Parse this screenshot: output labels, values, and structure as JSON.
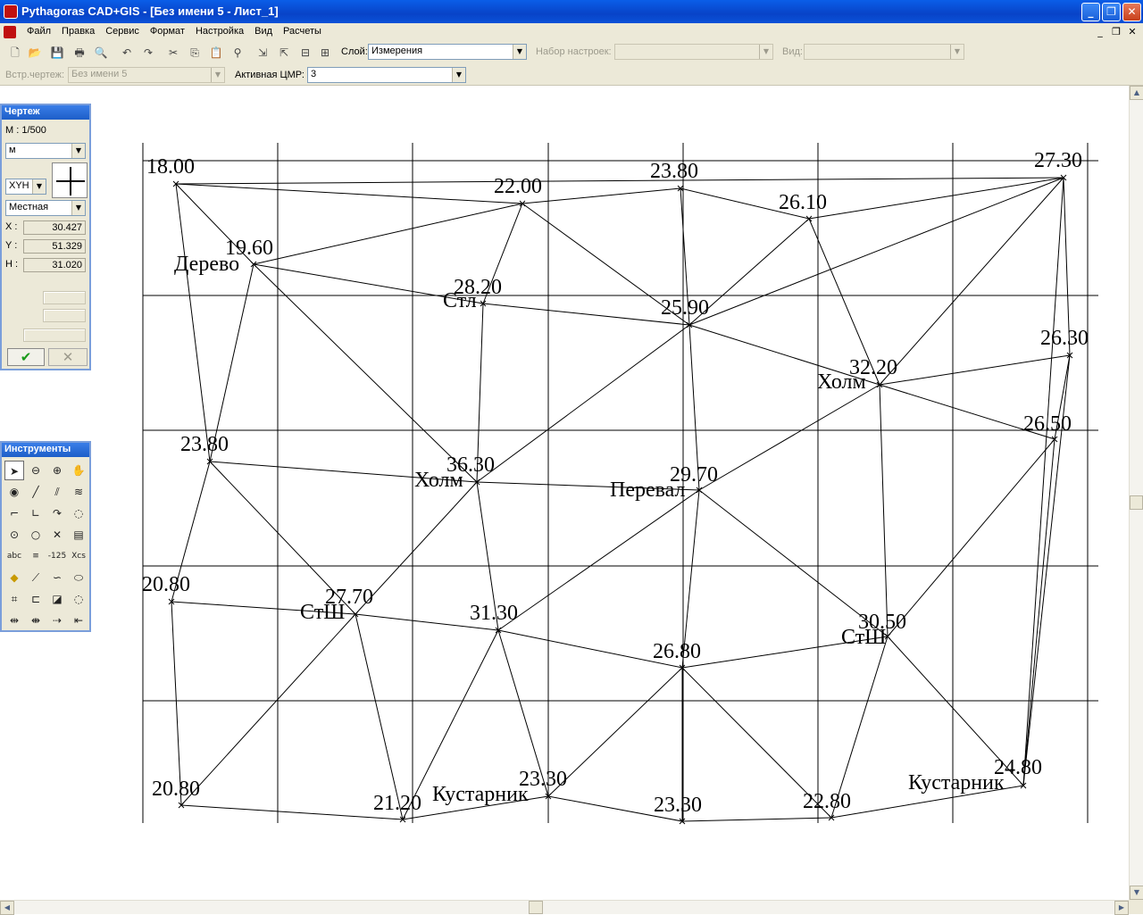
{
  "window": {
    "title": "Pythagoras CAD+GIS - [Без имени  5 - Лист_1]",
    "minimize": "_",
    "maximize": "❐",
    "close": "✕"
  },
  "menu": {
    "items": [
      "Файл",
      "Правка",
      "Сервис",
      "Формат",
      "Настройка",
      "Вид",
      "Расчеты"
    ],
    "mdi_minimize": "_",
    "mdi_restore": "❐",
    "mdi_close": "✕"
  },
  "toolbar": {
    "layer_label": "Слой:",
    "layer_value": "Измерения",
    "settings_label": "Набор настроек:",
    "settings_value": "",
    "view_label": "Вид:",
    "view_value": "",
    "embedded_label": "Встр.чертеж:",
    "embedded_value": "Без имени  5",
    "active_dtm_label": "Активная ЦМР:",
    "active_dtm_value": "3",
    "icons": [
      "new-file-icon",
      "open-folder-icon",
      "save-icon",
      "print-icon",
      "print-preview-icon",
      "undo-icon",
      "redo-icon",
      "cut-icon",
      "copy-icon",
      "paste-icon",
      "find-icon",
      "send-back-icon",
      "bring-front-icon",
      "align-icon",
      "distribute-icon"
    ]
  },
  "drawing_panel": {
    "title": "Чертеж",
    "scale": "М : 1/500",
    "unit": "м",
    "coord_mode": "XYH",
    "system": "Местная",
    "x_label": "X :",
    "x_value": "30.427",
    "y_label": "Y :",
    "y_value": "51.329",
    "h_label": "H :",
    "h_value": "31.020",
    "ok_icon": "✔",
    "cancel_icon": "✕"
  },
  "tools_panel": {
    "title": "Инструменты",
    "tools": [
      "select-icon",
      "zoom-out-icon",
      "zoom-in-icon",
      "pan-hand-icon",
      "point-icon",
      "line-icon",
      "parallel-line-icon",
      "multi-line-icon",
      "arc-icon",
      "corner-icon",
      "curve-icon",
      "circle-arc-icon",
      "circle-center-icon",
      "circle-icon",
      "intersection-icon",
      "hatch-icon",
      "text-abc-icon",
      "text-tool-icon",
      "elevation-label-icon",
      "coordinates-label-icon",
      "tag-icon",
      "edit-line-icon",
      "spline-icon",
      "ellipse-icon",
      "crop-icon",
      "trim-icon",
      "eraser-icon",
      "lasso-icon",
      "split-icon",
      "join-icon",
      "extend-icon",
      "snap-icon"
    ],
    "tool_glyphs": [
      "➤",
      "⊖",
      "⊕",
      "✋",
      "◉",
      "╱",
      "⫽",
      "≋",
      "⌐",
      "∟",
      "↷",
      "◌",
      "⊙",
      "○",
      "✕",
      "▤",
      "abc",
      "≡",
      "-125",
      "Xcs",
      "◆",
      "⟋",
      "∽",
      "⬭",
      "⌗",
      "⊏",
      "◪",
      "◌",
      "⇹",
      "⇼",
      "⇢",
      "⇤"
    ]
  },
  "map": {
    "points": [
      {
        "elev": "18.00",
        "name": ""
      },
      {
        "elev": "22.00",
        "name": ""
      },
      {
        "elev": "23.80",
        "name": ""
      },
      {
        "elev": "26.10",
        "name": ""
      },
      {
        "elev": "27.30",
        "name": ""
      },
      {
        "elev": "19.60",
        "name": "Дерево"
      },
      {
        "elev": "28.20",
        "name": "Стл"
      },
      {
        "elev": "25.90",
        "name": ""
      },
      {
        "elev": "26.30",
        "name": ""
      },
      {
        "elev": "32.20",
        "name": "Холм"
      },
      {
        "elev": "26.50",
        "name": ""
      },
      {
        "elev": "23.80",
        "name": ""
      },
      {
        "elev": "36.30",
        "name": "Холм"
      },
      {
        "elev": "29.70",
        "name": "Перевал"
      },
      {
        "elev": "20.80",
        "name": ""
      },
      {
        "elev": "27.70",
        "name": "СтШ"
      },
      {
        "elev": "31.30",
        "name": ""
      },
      {
        "elev": "26.80",
        "name": ""
      },
      {
        "elev": "30.50",
        "name": "СтШ"
      },
      {
        "elev": "20.80",
        "name": ""
      },
      {
        "elev": "21.20",
        "name": ""
      },
      {
        "elev": "23.30",
        "name": "Кустарник"
      },
      {
        "elev": "23.30",
        "name": ""
      },
      {
        "elev": "22.80",
        "name": ""
      },
      {
        "elev": "24.80",
        "name": "Кустарник"
      }
    ],
    "edges": [
      [
        0,
        1
      ],
      [
        1,
        2
      ],
      [
        2,
        3
      ],
      [
        3,
        4
      ],
      [
        0,
        4
      ],
      [
        0,
        5
      ],
      [
        0,
        11
      ],
      [
        1,
        5
      ],
      [
        1,
        6
      ],
      [
        1,
        7
      ],
      [
        2,
        7
      ],
      [
        3,
        7
      ],
      [
        3,
        9
      ],
      [
        4,
        7
      ],
      [
        4,
        8
      ],
      [
        4,
        9
      ],
      [
        4,
        24
      ],
      [
        5,
        6
      ],
      [
        5,
        11
      ],
      [
        5,
        12
      ],
      [
        6,
        7
      ],
      [
        6,
        12
      ],
      [
        7,
        9
      ],
      [
        7,
        12
      ],
      [
        7,
        13
      ],
      [
        8,
        9
      ],
      [
        8,
        10
      ],
      [
        8,
        24
      ],
      [
        9,
        10
      ],
      [
        9,
        13
      ],
      [
        9,
        18
      ],
      [
        10,
        18
      ],
      [
        10,
        24
      ],
      [
        11,
        12
      ],
      [
        11,
        14
      ],
      [
        11,
        15
      ],
      [
        12,
        13
      ],
      [
        12,
        15
      ],
      [
        12,
        16
      ],
      [
        13,
        16
      ],
      [
        13,
        17
      ],
      [
        13,
        18
      ],
      [
        14,
        15
      ],
      [
        14,
        19
      ],
      [
        15,
        16
      ],
      [
        15,
        19
      ],
      [
        15,
        20
      ],
      [
        16,
        17
      ],
      [
        16,
        20
      ],
      [
        16,
        21
      ],
      [
        17,
        18
      ],
      [
        17,
        21
      ],
      [
        17,
        22
      ],
      [
        17,
        23
      ],
      [
        18,
        23
      ],
      [
        18,
        24
      ],
      [
        19,
        20
      ],
      [
        20,
        21
      ],
      [
        21,
        22
      ],
      [
        22,
        23
      ],
      [
        23,
        24
      ]
    ]
  }
}
